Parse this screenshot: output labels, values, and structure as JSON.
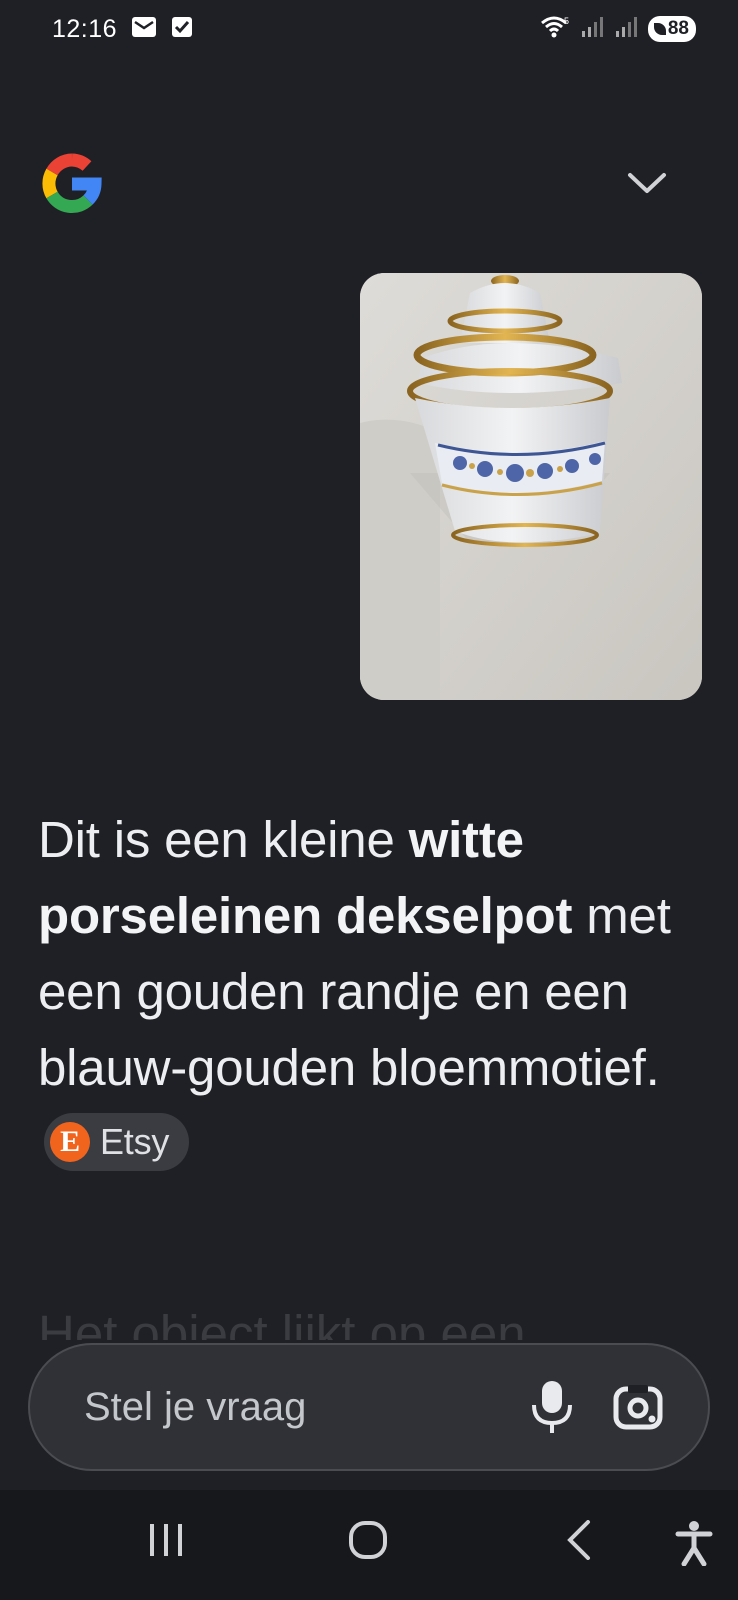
{
  "status_bar": {
    "time": "12:16",
    "battery": "88"
  },
  "header": {
    "logo_icon": "google-g-icon",
    "collapse_icon": "chevron-down-icon"
  },
  "photo": {
    "subject_icon": "porcelain-jar-photo"
  },
  "answer": {
    "part1": "Dit is een kleine ",
    "bold": "witte porseleinen dekselpot",
    "part2": " met een gouden randje en een blauw-gouden bloemmotief.",
    "source_chip": {
      "icon_letter": "E",
      "label": "Etsy",
      "color": "#f1641e"
    },
    "next_line_faded": "Het object lijkt op een"
  },
  "search": {
    "placeholder": "Stel je vraag"
  },
  "nav": {
    "recent_icon": "recent-apps-icon",
    "home_icon": "home-icon",
    "back_icon": "back-icon",
    "accessibility_icon": "accessibility-icon"
  }
}
